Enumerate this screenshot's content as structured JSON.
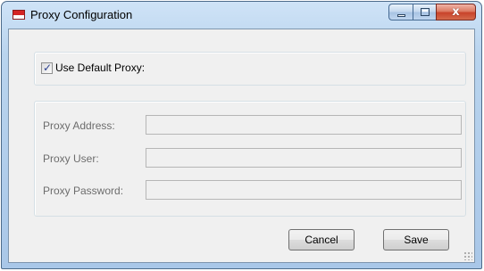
{
  "window": {
    "title": "Proxy Configuration",
    "close_glyph": "x"
  },
  "default_proxy": {
    "label": "Use Default Proxy:",
    "checked": true
  },
  "fields": [
    {
      "label": "Proxy Address:",
      "value": ""
    },
    {
      "label": "Proxy User:",
      "value": ""
    },
    {
      "label": "Proxy Password:",
      "value": ""
    }
  ],
  "buttons": {
    "cancel": "Cancel",
    "save": "Save"
  },
  "icons": [
    "app-icon",
    "minimize-icon",
    "maximize-icon",
    "close-icon",
    "checkbox-check-icon",
    "resize-grip-icon"
  ]
}
